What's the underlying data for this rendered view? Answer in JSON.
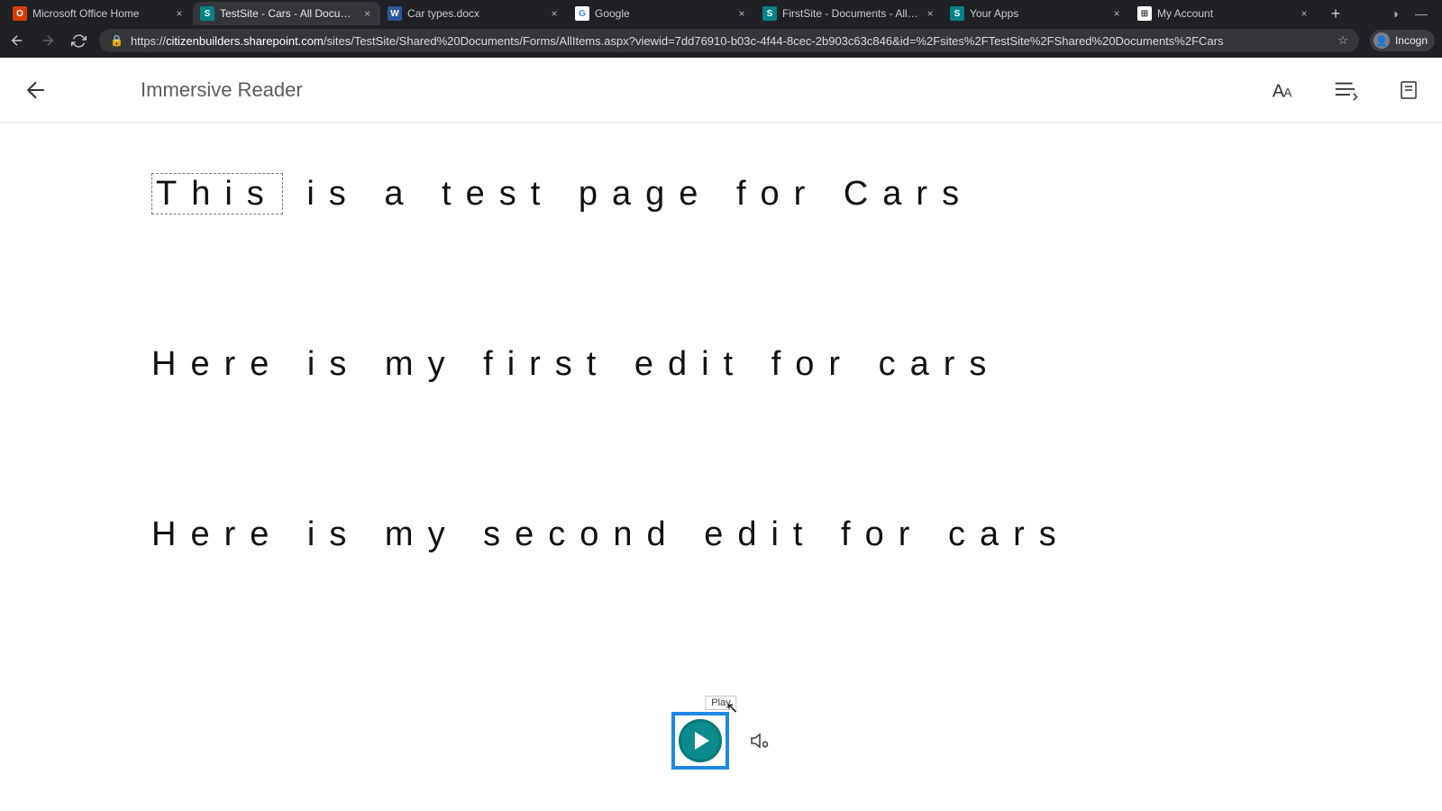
{
  "browser": {
    "tabs": [
      {
        "title": "Microsoft Office Home",
        "favicon_bg": "#d83b01",
        "favicon_text": "O",
        "active": false
      },
      {
        "title": "TestSite - Cars - All Documents",
        "favicon_bg": "#038387",
        "favicon_text": "S",
        "active": true
      },
      {
        "title": "Car types.docx",
        "favicon_bg": "#2b579a",
        "favicon_text": "W",
        "active": false
      },
      {
        "title": "Google",
        "favicon_bg": "#ffffff",
        "favicon_text": "G",
        "active": false
      },
      {
        "title": "FirstSite - Documents - All Docu...",
        "favicon_bg": "#038387",
        "favicon_text": "S",
        "active": false
      },
      {
        "title": "Your Apps",
        "favicon_bg": "#038387",
        "favicon_text": "S",
        "active": false
      },
      {
        "title": "My Account",
        "favicon_bg": "#ffffff",
        "favicon_text": "⊞",
        "active": false
      }
    ],
    "url_host": "citizenbuilders.sharepoint.com",
    "url_path": "/sites/TestSite/Shared%20Documents/Forms/AllItems.aspx?viewid=7dd76910-b03c-4f44-8cec-2b903c63c846&id=%2Fsites%2FTestSite%2FShared%20Documents%2FCars",
    "profile_label": "Incogn"
  },
  "header": {
    "title": "Immersive Reader"
  },
  "content": {
    "line1_highlight": "This",
    "line1_rest": " is a test page for Cars",
    "line2": "Here is my first edit for cars",
    "line3": "Here is my second edit for cars"
  },
  "playback": {
    "tooltip": "Play"
  }
}
